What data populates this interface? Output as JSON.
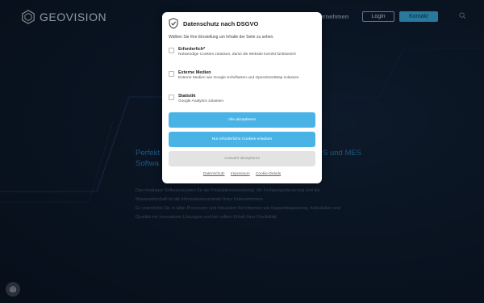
{
  "header": {
    "logo_text": "GEOVISION",
    "nav_partial": "ternehmen",
    "login_label": "Login",
    "contact_label": "Kontakt"
  },
  "hero": {
    "subtitle_left": "Perfekt",
    "subtitle_right": "S und MES",
    "subtitle_line2": "Softwa",
    "body_lines": [
      "Das modulare Softwaresystem für die Produktionssteuerung, die Fertigungssteuerung und die",
      "Warenwirtschaft ist die Informationszentrale Ihres Unternehmens.",
      "Es unterstützt Sie in allen Prozessen und fokussiert Kernthemen wie Kapazitätsplanung, Kalkulation und",
      "Qualität mit innovativen Lösungen und bei vollem Erhalt Ihrer Flexibilität."
    ]
  },
  "consent": {
    "title": "Datenschutz nach DSGVO",
    "intro": "Wählen Sie Ihre Einstellung um Inhalte der Seite zu sehen.",
    "options": [
      {
        "title": "Erforderlich*",
        "desc": "Notwendige Cookies zulassen, damit die Website korrekt funktioniert"
      },
      {
        "title": "Externe Medien",
        "desc": "Externe Medien wie Google Schriftarten und OpenStreetMap zulassen"
      },
      {
        "title": "Statistik",
        "desc": "Google Analytics zulassen"
      }
    ],
    "accept_all": "Alle akzeptieren",
    "only_required": "Nur erforderliche Cookies erlauben",
    "accept_selection": "Auswahl akzeptieren",
    "links": [
      "Datenschutz",
      "Impressum",
      "Cookie-Details"
    ]
  },
  "colors": {
    "background": "#0d1a2c",
    "accent": "#4ab3e6",
    "contact_button": "#3aa8d8"
  },
  "icons": {
    "logo": "hexagon-logo-icon",
    "search": "search-icon",
    "shield": "shield-check-icon",
    "fingerprint": "fingerprint-icon"
  }
}
